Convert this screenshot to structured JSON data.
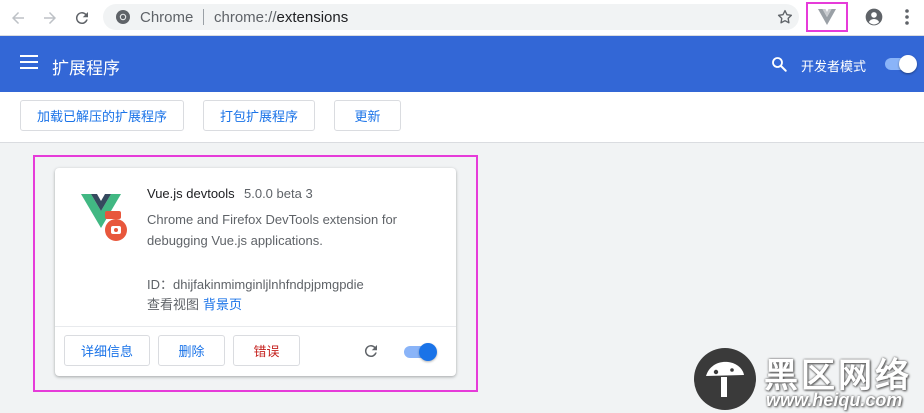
{
  "browser": {
    "omnibox_label": "Chrome",
    "url_scheme": "chrome://",
    "url_path": "extensions"
  },
  "header": {
    "title": "扩展程序",
    "developer_mode_label": "开发者模式",
    "developer_mode_on": true,
    "accent_color": "#3367d6"
  },
  "actions": {
    "load_unpacked": "加载已解压的扩展程序",
    "pack": "打包扩展程序",
    "update": "更新"
  },
  "extension": {
    "name": "Vue.js devtools",
    "version": "5.0.0 beta 3",
    "description": "Chrome and Firefox DevTools extension for debugging Vue.js applications.",
    "id_text": "ID：dhijfakinmimginljlnhfndpjpmgpdie",
    "inspect_views_label": "查看视图",
    "background_page_link": "背景页",
    "details_button": "详细信息",
    "remove_button": "删除",
    "errors_button": "错误",
    "enabled": true
  },
  "watermark": {
    "title": "黑区网络",
    "url": "www.heiqu.com"
  },
  "icons": {
    "back": "back-arrow-icon",
    "forward": "forward-arrow-icon",
    "reload": "reload-icon",
    "site_info": "chrome-logo-icon",
    "bookmark": "star-icon",
    "extension": "vue-devtools-icon",
    "profile": "account-circle-icon",
    "menu": "more-vert-icon",
    "hamburger": "menu-icon",
    "search": "search-icon"
  },
  "colors": {
    "highlight": "#e63bd9",
    "link": "#1a73e8",
    "error": "#c5221f"
  }
}
